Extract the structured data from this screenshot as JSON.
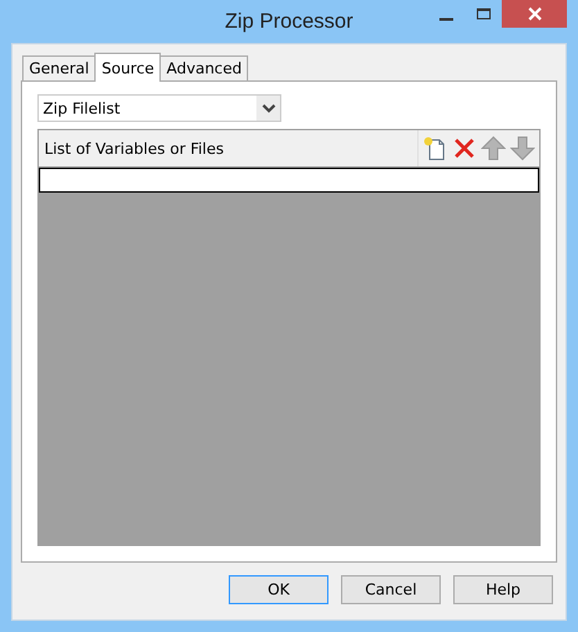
{
  "window": {
    "title": "Zip Processor"
  },
  "tabs": [
    {
      "label": "General",
      "selected": false
    },
    {
      "label": "Source",
      "selected": true
    },
    {
      "label": "Advanced",
      "selected": false
    }
  ],
  "source_dropdown": {
    "value": "Zip Filelist"
  },
  "list": {
    "header": "List of Variables or Files"
  },
  "buttons": [
    {
      "label": "OK",
      "default": true
    },
    {
      "label": "Cancel",
      "default": false
    },
    {
      "label": "Help",
      "default": false
    }
  ]
}
